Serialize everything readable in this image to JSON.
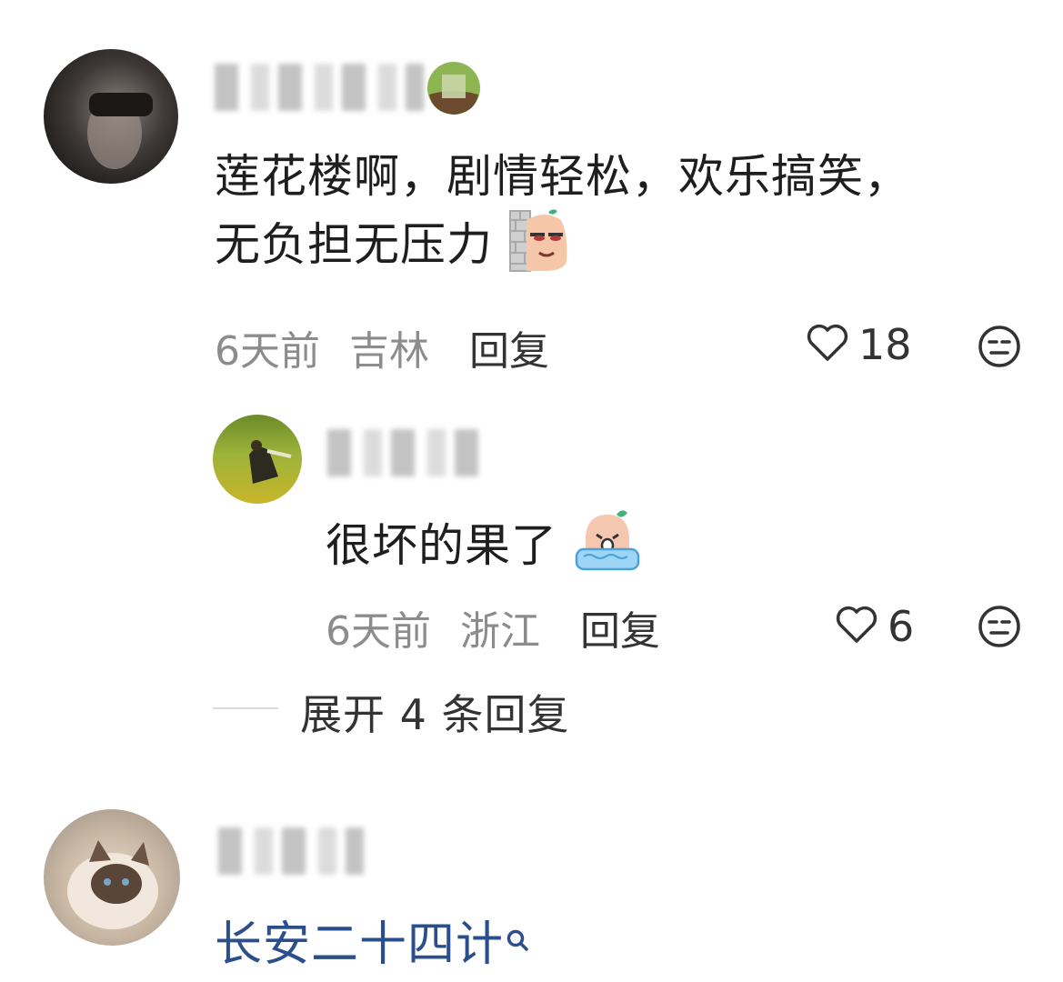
{
  "comments": [
    {
      "content_line1": "莲花楼啊，剧情轻松，欢乐搞笑，",
      "content_line2": "无负担无压力",
      "time": "6天前",
      "location": "吉林",
      "reply_label": "回复",
      "likes": "18",
      "reply": {
        "content": "很坏的果了",
        "time": "6天前",
        "location": "浙江",
        "reply_label": "回复",
        "likes": "6"
      },
      "expand_label": "展开 4 条回复"
    },
    {
      "link_text": "长安二十四计"
    }
  ],
  "icons": {
    "like": "heart-icon",
    "dislike": "meh-face-icon",
    "search": "search-icon"
  },
  "colors": {
    "link": "#2b4f8c",
    "meta": "#8c8c8c",
    "text": "#1e1e1e"
  }
}
